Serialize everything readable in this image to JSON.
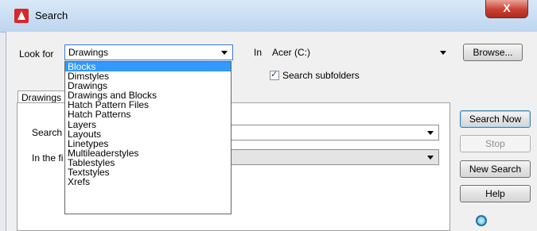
{
  "window": {
    "title": "Search",
    "close_glyph": "X"
  },
  "form": {
    "look_for_label": "Look for",
    "look_for_value": "Drawings",
    "in_label": "In",
    "in_value": "Acer (C:)",
    "search_subfolders_label": "Search subfolders",
    "search_subfolders_checked": true
  },
  "dropdown": {
    "items": [
      "Blocks",
      "Dimstyles",
      "Drawings",
      "Drawings and Blocks",
      "Hatch Pattern Files",
      "Hatch Patterns",
      "Layers",
      "Layouts",
      "Linetypes",
      "Multileaderstyles",
      "Tablestyles",
      "Textstyles",
      "Xrefs"
    ],
    "selected": "Blocks"
  },
  "tab": {
    "label": "Drawings"
  },
  "panel": {
    "search_label": "Search",
    "in_the_field_label": "In the fi"
  },
  "buttons": {
    "browse": "Browse...",
    "search_now": "Search Now",
    "stop": "Stop",
    "new_search": "New Search",
    "help": "Help"
  },
  "colors": {
    "selection": "#3399ff",
    "close": "#c84132"
  }
}
